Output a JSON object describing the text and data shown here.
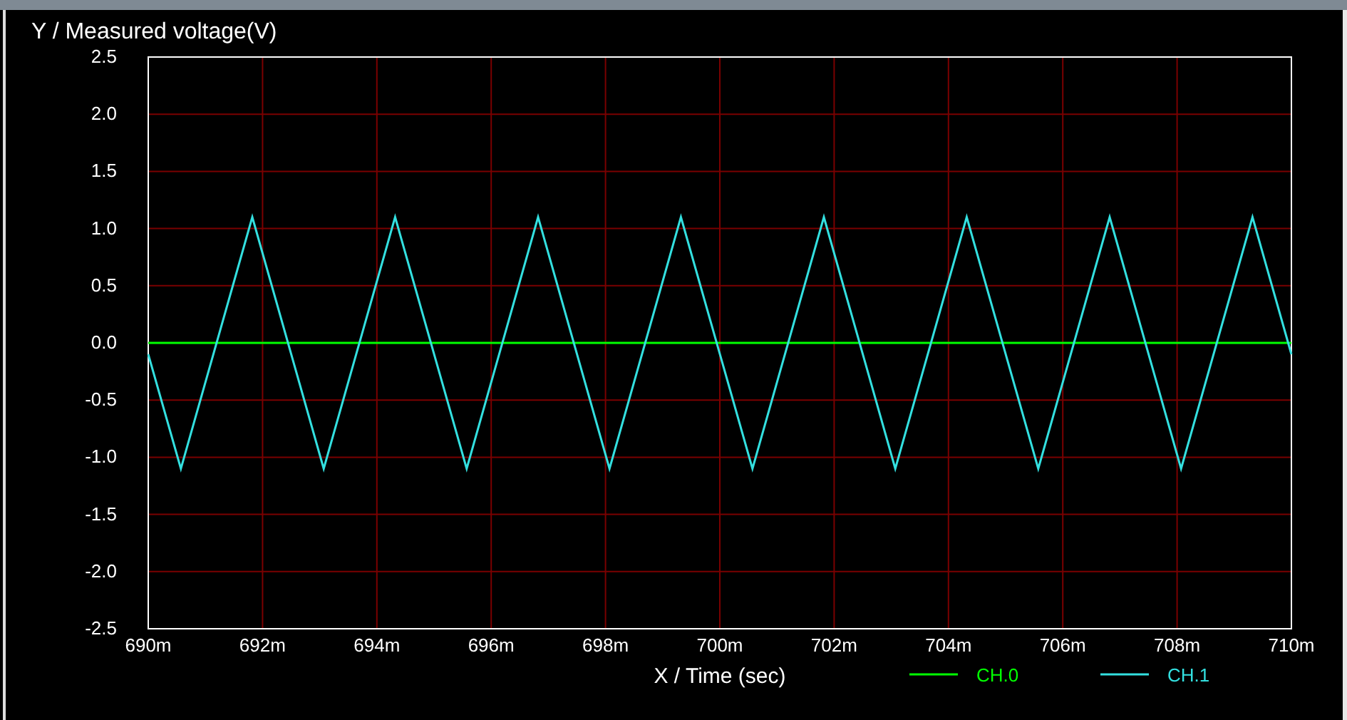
{
  "chart_data": {
    "type": "line",
    "ylabel": "Y / Measured voltage(V)",
    "xlabel": "X / Time (sec)",
    "x": [
      690,
      690.57,
      691.82,
      693.07,
      694.32,
      695.57,
      696.82,
      698.07,
      699.32,
      700.57,
      701.82,
      703.07,
      704.32,
      705.57,
      706.82,
      708.07,
      709.32,
      710
    ],
    "series": [
      {
        "name": "CH.0",
        "color": "#00ff00",
        "values": [
          0,
          0,
          0,
          0,
          0,
          0,
          0,
          0,
          0,
          0,
          0,
          0,
          0,
          0,
          0,
          0,
          0,
          0
        ]
      },
      {
        "name": "CH.1",
        "color": "#33e0e0",
        "values": [
          -0.1,
          -1.1,
          1.1,
          -1.1,
          1.1,
          -1.1,
          1.1,
          -1.1,
          1.1,
          -1.1,
          1.1,
          -1.1,
          1.1,
          -1.1,
          1.1,
          -1.1,
          1.1,
          -0.1
        ]
      }
    ],
    "grid": true,
    "legend": true,
    "xlim": [
      690,
      710
    ],
    "ylim": [
      -2.5,
      2.5
    ],
    "xticks": [
      {
        "value": 690,
        "label": "690m"
      },
      {
        "value": 692,
        "label": "692m"
      },
      {
        "value": 694,
        "label": "694m"
      },
      {
        "value": 696,
        "label": "696m"
      },
      {
        "value": 698,
        "label": "698m"
      },
      {
        "value": 700,
        "label": "700m"
      },
      {
        "value": 702,
        "label": "702m"
      },
      {
        "value": 704,
        "label": "704m"
      },
      {
        "value": 706,
        "label": "706m"
      },
      {
        "value": 708,
        "label": "708m"
      },
      {
        "value": 710,
        "label": "710m"
      }
    ],
    "yticks": [
      {
        "value": 2.5,
        "label": "2.5"
      },
      {
        "value": 2,
        "label": "2.0"
      },
      {
        "value": 1.5,
        "label": "1.5"
      },
      {
        "value": 1,
        "label": "1.0"
      },
      {
        "value": 0.5,
        "label": "0.5"
      },
      {
        "value": 0,
        "label": "0.0"
      },
      {
        "value": -0.5,
        "label": "-0.5"
      },
      {
        "value": -1,
        "label": "-1.0"
      },
      {
        "value": -1.5,
        "label": "-1.5"
      },
      {
        "value": -2,
        "label": "-2.0"
      },
      {
        "value": -2.5,
        "label": "-2.5"
      }
    ]
  }
}
